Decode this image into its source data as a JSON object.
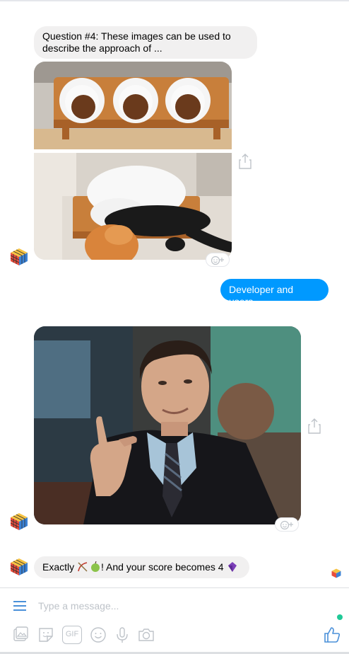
{
  "messages": {
    "question_text": "Question #4: These images can be used to describe the approach of ...",
    "user_reply": "Developer and users",
    "result_prefix": "Exactly ",
    "result_suffix": "! And your score becomes 4 "
  },
  "composer": {
    "placeholder": "Type a message...",
    "gif_label": "GIF"
  },
  "colors": {
    "accent": "#0099ff",
    "incoming_bubble": "#f1f0f0",
    "online": "#20c997",
    "icon": "#4a90d9"
  }
}
